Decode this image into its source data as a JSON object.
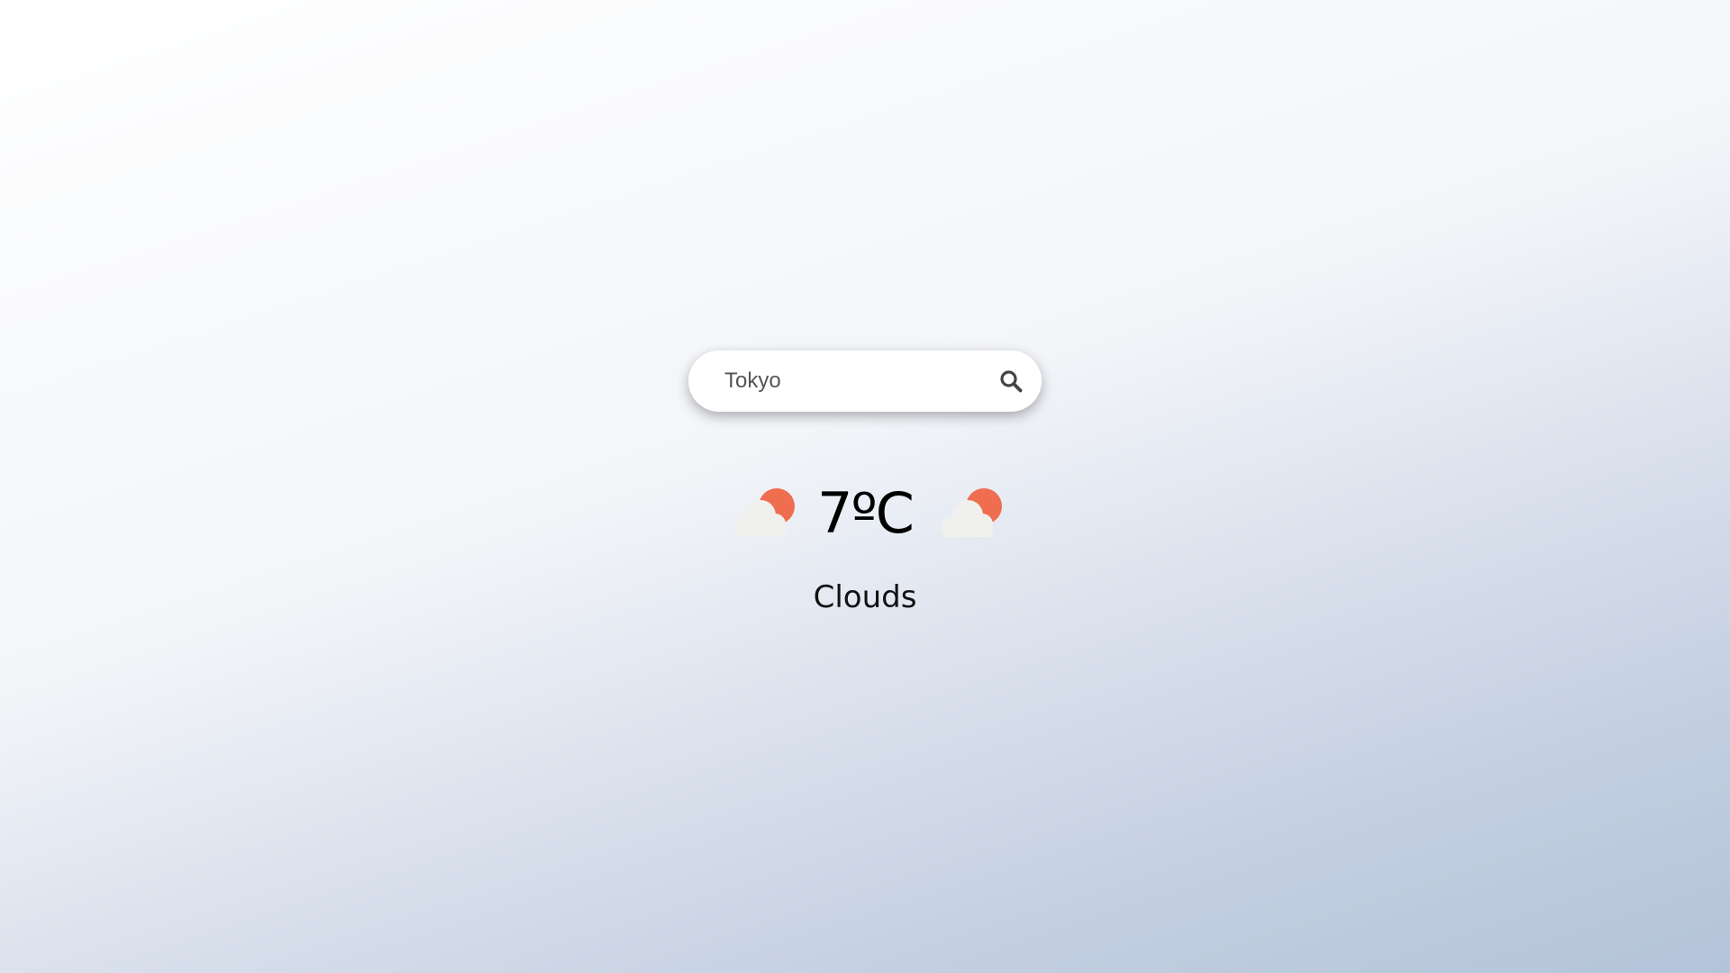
{
  "search": {
    "value": "Tokyo",
    "icon": "search-icon"
  },
  "weather": {
    "temperature": "7ºC",
    "condition": "Clouds",
    "icon": "partly-cloudy-icon"
  },
  "colors": {
    "sun": "#ee6e4f",
    "cloud": "#f0f0ee",
    "search_icon": "#444444"
  }
}
